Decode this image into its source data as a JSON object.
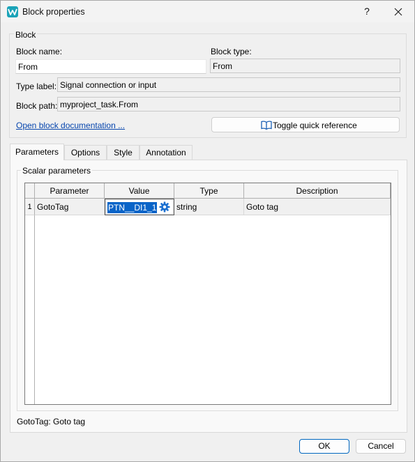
{
  "window": {
    "title": "Block properties",
    "help_label": "?"
  },
  "block_group": {
    "title": "Block",
    "name_label": "Block name:",
    "name_value": "From",
    "type_label": "Block type:",
    "type_value": "From",
    "typelabel_label": "Type label:",
    "typelabel_value": "Signal connection or input",
    "path_label": "Block path:",
    "path_value": "myproject_task.From",
    "doc_link": "Open block documentation ...",
    "toggle_button": "Toggle quick reference"
  },
  "tabs": [
    {
      "label": "Parameters",
      "active": true
    },
    {
      "label": "Options",
      "active": false
    },
    {
      "label": "Style",
      "active": false
    },
    {
      "label": "Annotation",
      "active": false
    }
  ],
  "parameters": {
    "group_title": "Scalar parameters",
    "columns": [
      "Parameter",
      "Value",
      "Type",
      "Description"
    ],
    "rows": [
      {
        "index": "1",
        "parameter": "GotoTag",
        "value": "PTN__DI1_1",
        "type": "string",
        "description": "Goto tag"
      }
    ],
    "status_text": "GotoTag: Goto tag"
  },
  "footer": {
    "ok_label": "OK",
    "cancel_label": "Cancel"
  },
  "colors": {
    "accent": "#0067c0",
    "selection": "#0a64c8",
    "link": "#0645ad",
    "app_icon": "#1aa3b8"
  },
  "icons": [
    "app-logo-icon",
    "help-icon",
    "close-icon",
    "book-icon",
    "gear-icon"
  ]
}
